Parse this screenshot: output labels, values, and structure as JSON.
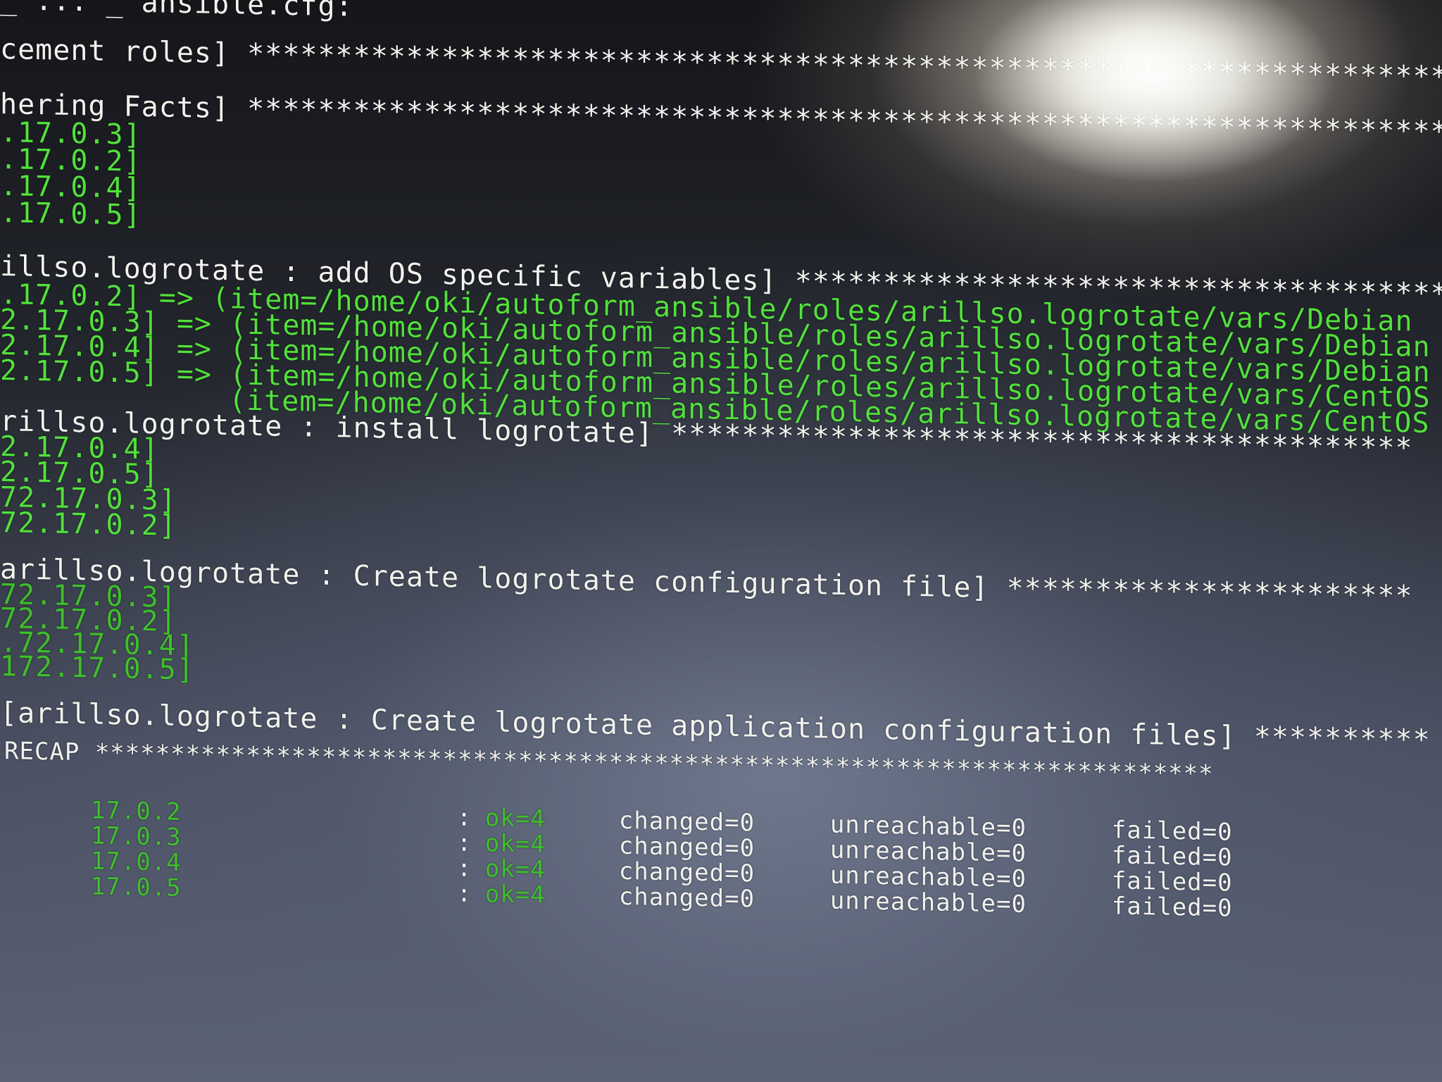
{
  "terminal": {
    "config_fragment": "_ ... _ ansible.cfg:",
    "play_header": "cement roles] ************************************************************************",
    "tasks": [
      {
        "header": "hering Facts] ************************************************************************",
        "hosts": [
          ".17.0.3]",
          ".17.0.2]",
          ".17.0.4]",
          ".17.0.5]"
        ]
      },
      {
        "header": "illso.logrotate : add OS specific variables] ***************************************",
        "items": [
          ".17.0.2] => (item=/home/oki/autoform_ansible/roles/arillso.logrotate/vars/Debian",
          "2.17.0.3] => (item=/home/oki/autoform_ansible/roles/arillso.logrotate/vars/Debian",
          "2.17.0.4] => (item=/home/oki/autoform_ansible/roles/arillso.logrotate/vars/Debian",
          "2.17.0.5] => (item=/home/oki/autoform_ansible/roles/arillso.logrotate/vars/CentOS",
          "(item=/home/oki/autoform_ansible/roles/arillso.logrotate/vars/CentOS"
        ]
      },
      {
        "header": "rillso.logrotate : install logrotate] ******************************************",
        "hosts": [
          "2.17.0.4]",
          "2.17.0.5]",
          "72.17.0.3]",
          "72.17.0.2]"
        ]
      },
      {
        "header": "arillso.logrotate : Create logrotate configuration file] ***********************",
        "hosts": [
          "72.17.0.3]",
          "72.17.0.2]",
          ".72.17.0.4]",
          "172.17.0.5]"
        ]
      },
      {
        "header": "[arillso.logrotate : Create logrotate application configuration files] **********"
      }
    ],
    "recap": {
      "header": "RECAP **************************************************************************",
      "rows": [
        {
          "host": "17.0.2",
          "sep": ":",
          "ok": "ok=4",
          "changed": "changed=0",
          "unreachable": "unreachable=0",
          "failed": "failed=0"
        },
        {
          "host": "17.0.3",
          "sep": ":",
          "ok": "ok=4",
          "changed": "changed=0",
          "unreachable": "unreachable=0",
          "failed": "failed=0"
        },
        {
          "host": "17.0.4",
          "sep": ":",
          "ok": "ok=4",
          "changed": "changed=0",
          "unreachable": "unreachable=0",
          "failed": "failed=0"
        },
        {
          "host": "17.0.5",
          "sep": ":",
          "ok": "ok=4",
          "changed": "changed=0",
          "unreachable": "unreachable=0",
          "failed": "failed=0"
        }
      ]
    }
  },
  "colors": {
    "text_white": "#f2f2ee",
    "text_green": "#52e13c",
    "background": "#24272e"
  }
}
